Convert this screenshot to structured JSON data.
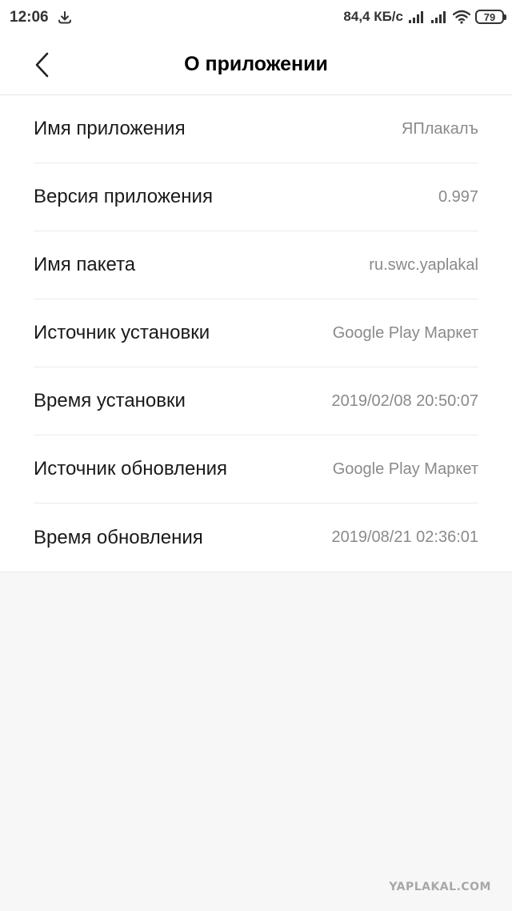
{
  "status_bar": {
    "time": "12:06",
    "download_icon": "download-arrow-icon",
    "network_speed": "84,4 КБ/с",
    "signal_icons": [
      "signal-icon",
      "signal-icon"
    ],
    "wifi_icon": "wifi-icon",
    "battery_level": "79"
  },
  "header": {
    "back_icon": "chevron-left-icon",
    "title": "О приложении"
  },
  "info": {
    "rows": [
      {
        "label": "Имя приложения",
        "value": "ЯПлакалъ"
      },
      {
        "label": "Версия приложения",
        "value": "0.997"
      },
      {
        "label": "Имя пакета",
        "value": "ru.swc.yaplakal"
      },
      {
        "label": "Источник установки",
        "value": "Google Play Маркет"
      },
      {
        "label": "Время установки",
        "value": "2019/02/08 20:50:07"
      },
      {
        "label": "Источник обновления",
        "value": "Google Play Маркет"
      },
      {
        "label": "Время обновления",
        "value": "2019/08/21 02:36:01"
      }
    ]
  },
  "watermark": "YAPLAKAL.COM",
  "colors": {
    "page_background": "#f7f7f7",
    "card_background": "#ffffff",
    "label_text": "#1a1a1a",
    "value_text": "#8a8a8a"
  }
}
